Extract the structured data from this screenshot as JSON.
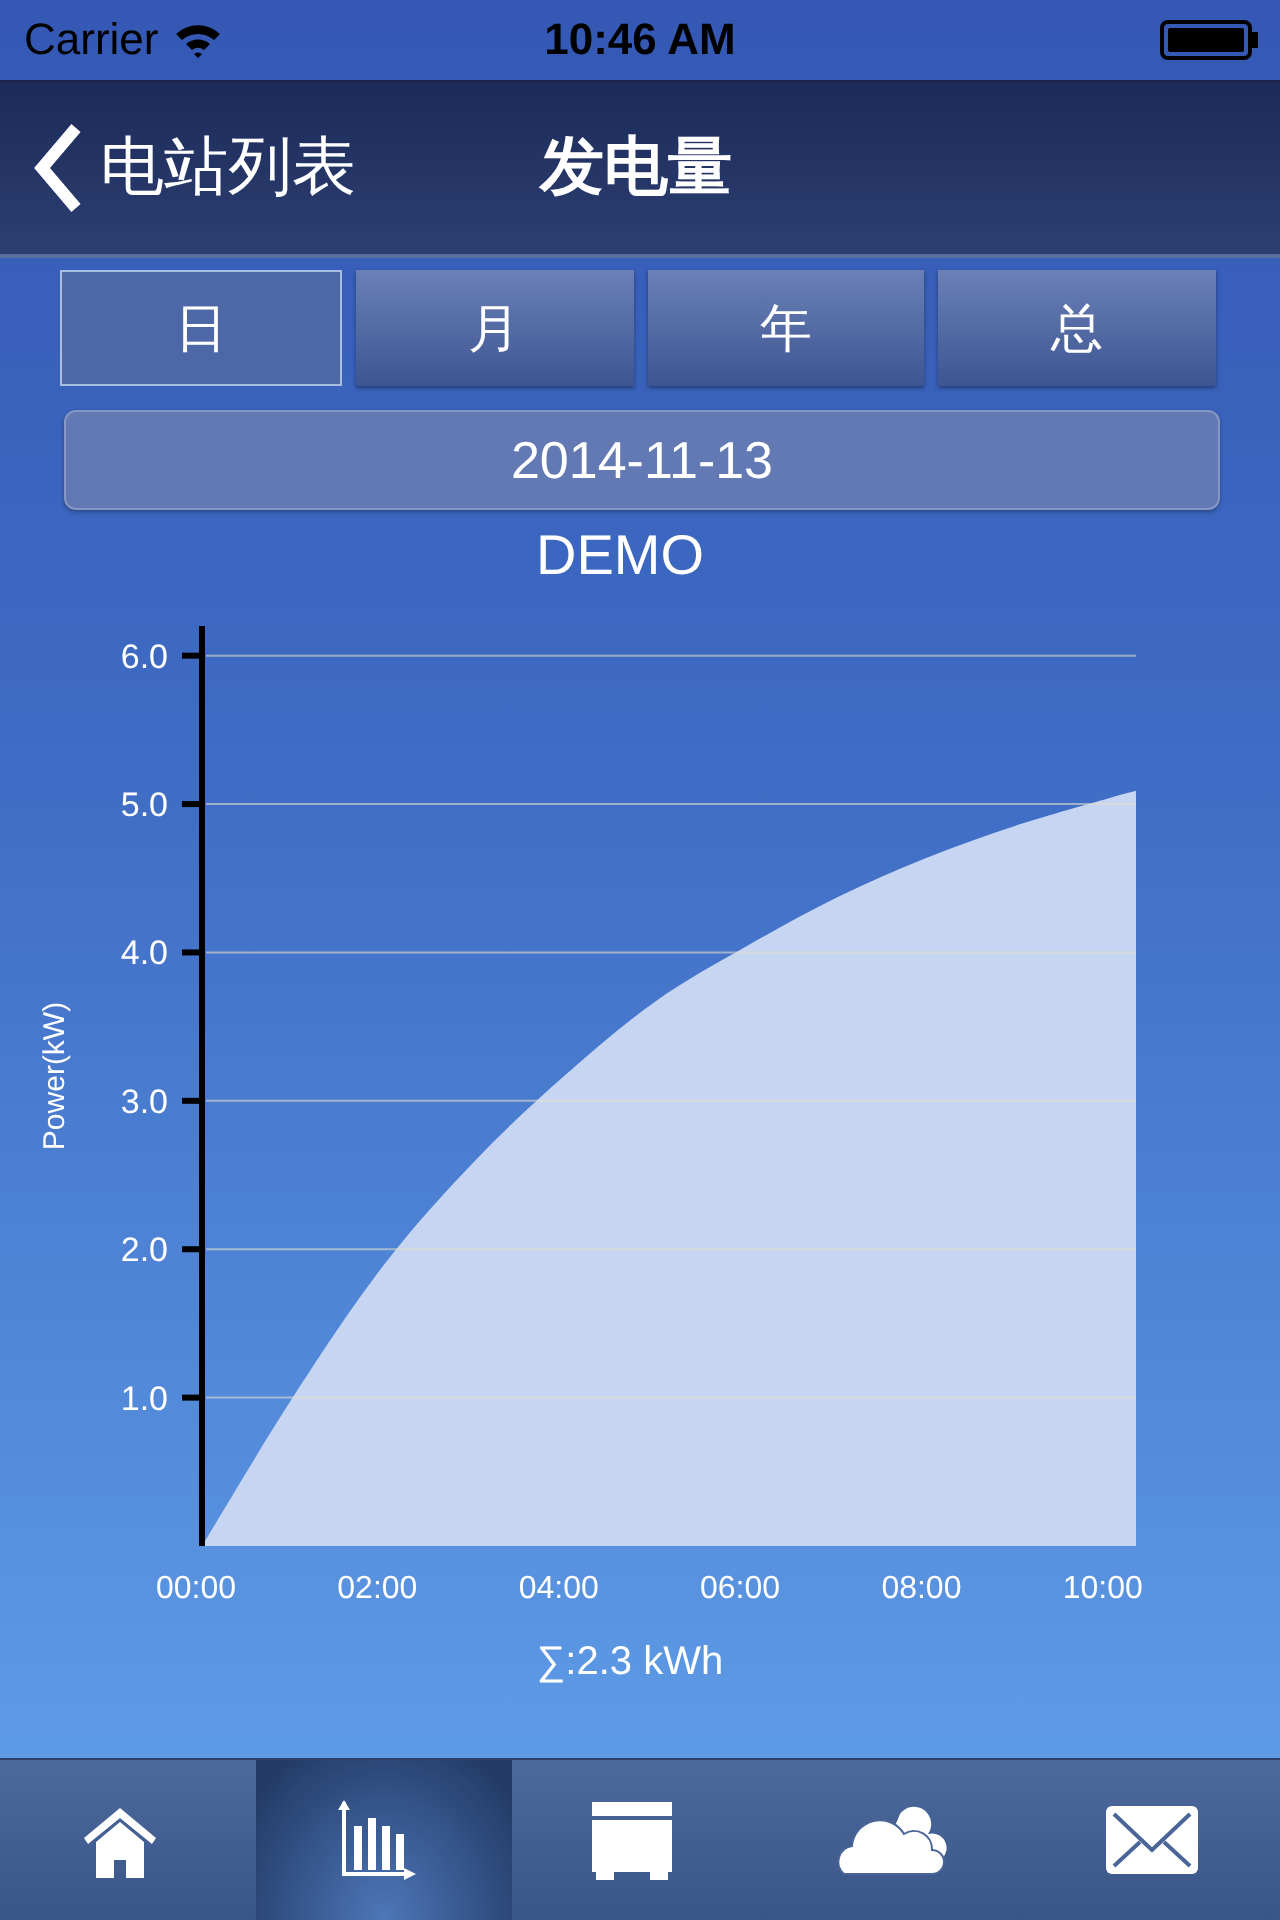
{
  "status_bar": {
    "carrier": "Carrier",
    "time": "10:46 AM"
  },
  "nav_bar": {
    "back_label": "电站列表",
    "title": "发电量"
  },
  "period_tabs": [
    {
      "label": "日",
      "selected": true
    },
    {
      "label": "月",
      "selected": false
    },
    {
      "label": "年",
      "selected": false
    },
    {
      "label": "总",
      "selected": false
    }
  ],
  "date": "2014-11-13",
  "chart": {
    "chart_data": {
      "type": "area",
      "title": "DEMO",
      "ylabel": "Power(kW)",
      "x": [
        0,
        1,
        2,
        3,
        4,
        5,
        6,
        7,
        8,
        9,
        10,
        10.3
      ],
      "series": [
        {
          "color": "#c6d6f2",
          "values": [
            0,
            1.0,
            1.89,
            2.59,
            3.17,
            3.67,
            4.04,
            4.37,
            4.64,
            4.86,
            5.04,
            5.09
          ]
        }
      ],
      "xlim": [
        0,
        10.3
      ],
      "ylim": [
        0,
        6.2
      ],
      "grid": true,
      "xticks": [
        {
          "value": 0,
          "label": "00:00"
        },
        {
          "value": 2,
          "label": "02:00"
        },
        {
          "value": 4,
          "label": "04:00"
        },
        {
          "value": 6,
          "label": "06:00"
        },
        {
          "value": 8,
          "label": "08:00"
        },
        {
          "value": 10,
          "label": "10:00"
        }
      ],
      "yticks": [
        {
          "value": 1,
          "label": "1.0"
        },
        {
          "value": 2,
          "label": "2.0"
        },
        {
          "value": 3,
          "label": "3.0"
        },
        {
          "value": 4,
          "label": "4.0"
        },
        {
          "value": 5,
          "label": "5.0"
        },
        {
          "value": 6,
          "label": "6.0"
        }
      ]
    },
    "total": "∑:2.3 kWh"
  },
  "tab_bar": [
    {
      "kind": "home",
      "selected": false
    },
    {
      "kind": "chart",
      "selected": true
    },
    {
      "kind": "device",
      "selected": false
    },
    {
      "kind": "weather",
      "selected": false
    },
    {
      "kind": "mail",
      "selected": false
    }
  ]
}
